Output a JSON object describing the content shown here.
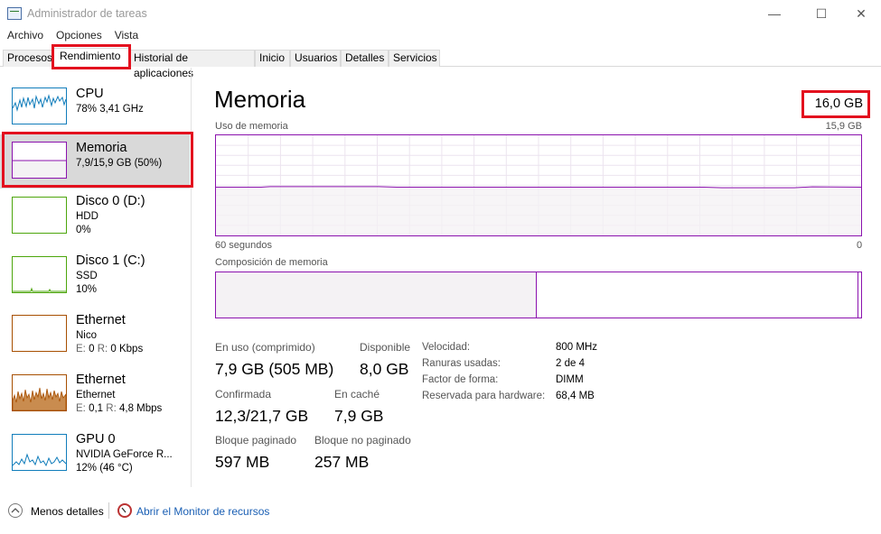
{
  "window": {
    "title": "Administrador de tareas",
    "minimize_glyph": "—",
    "maximize_glyph": "☐",
    "close_glyph": "✕"
  },
  "menu": [
    "Archivo",
    "Opciones",
    "Vista"
  ],
  "tabs": [
    "Procesos",
    "Rendimiento",
    "Historial de aplicaciones",
    "Inicio",
    "Usuarios",
    "Detalles",
    "Servicios"
  ],
  "sidebar": {
    "items": [
      {
        "name": "CPU",
        "lines": [
          "78% 3,41 GHz"
        ],
        "color": "#117dbb"
      },
      {
        "name": "Memoria",
        "lines": [
          "7,9/15,9 GB (50%)"
        ],
        "color": "#8b12ae"
      },
      {
        "name": "Disco 0 (D:)",
        "lines": [
          "HDD",
          "0%"
        ],
        "color": "#4da60c"
      },
      {
        "name": "Disco 1 (C:)",
        "lines": [
          "SSD",
          "10%"
        ],
        "color": "#4da60c"
      },
      {
        "name": "Ethernet",
        "lines": [
          "Nico"
        ],
        "stat": {
          "e_label": "E:",
          "e_val": "0",
          "r_label": "R:",
          "r_val": "0 Kbps"
        },
        "color": "#a74f01"
      },
      {
        "name": "Ethernet",
        "lines": [
          "Ethernet"
        ],
        "stat": {
          "e_label": "E:",
          "e_val": "0,1",
          "r_label": "R:",
          "r_val": "4,8 Mbps"
        },
        "color": "#a74f01"
      },
      {
        "name": "GPU 0",
        "lines": [
          "NVIDIA GeForce R...",
          "12% (46 °C)"
        ],
        "color": "#117dbb"
      }
    ]
  },
  "main": {
    "title": "Memoria",
    "total": "16,0 GB",
    "usage_label": "Uso de memoria",
    "usage_max": "15,9 GB",
    "time_left": "60 segundos",
    "time_right": "0",
    "composition_label": "Composición de memoria",
    "usage_fraction": 0.5
  },
  "stats": {
    "in_use_label": "En uso (comprimido)",
    "in_use_value": "7,9 GB (505 MB)",
    "available_label": "Disponible",
    "available_value": "8,0 GB",
    "committed_label": "Confirmada",
    "committed_value": "12,3/21,7 GB",
    "cached_label": "En caché",
    "cached_value": "7,9 GB",
    "paged_label": "Bloque paginado",
    "paged_value": "597 MB",
    "nonpaged_label": "Bloque no paginado",
    "nonpaged_value": "257 MB"
  },
  "details": [
    {
      "key": "Velocidad:",
      "value": "800 MHz"
    },
    {
      "key": "Ranuras usadas:",
      "value": "2 de 4"
    },
    {
      "key": "Factor de forma:",
      "value": "DIMM"
    },
    {
      "key": "Reservada para hardware:",
      "value": "68,4 MB"
    }
  ],
  "footer": {
    "less_details": "Menos detalles",
    "resource_monitor": "Abrir el Monitor de recursos"
  },
  "colors": {
    "memory": "#8b12ae",
    "highlight": "#e3101e",
    "link": "#1a5fb4"
  }
}
